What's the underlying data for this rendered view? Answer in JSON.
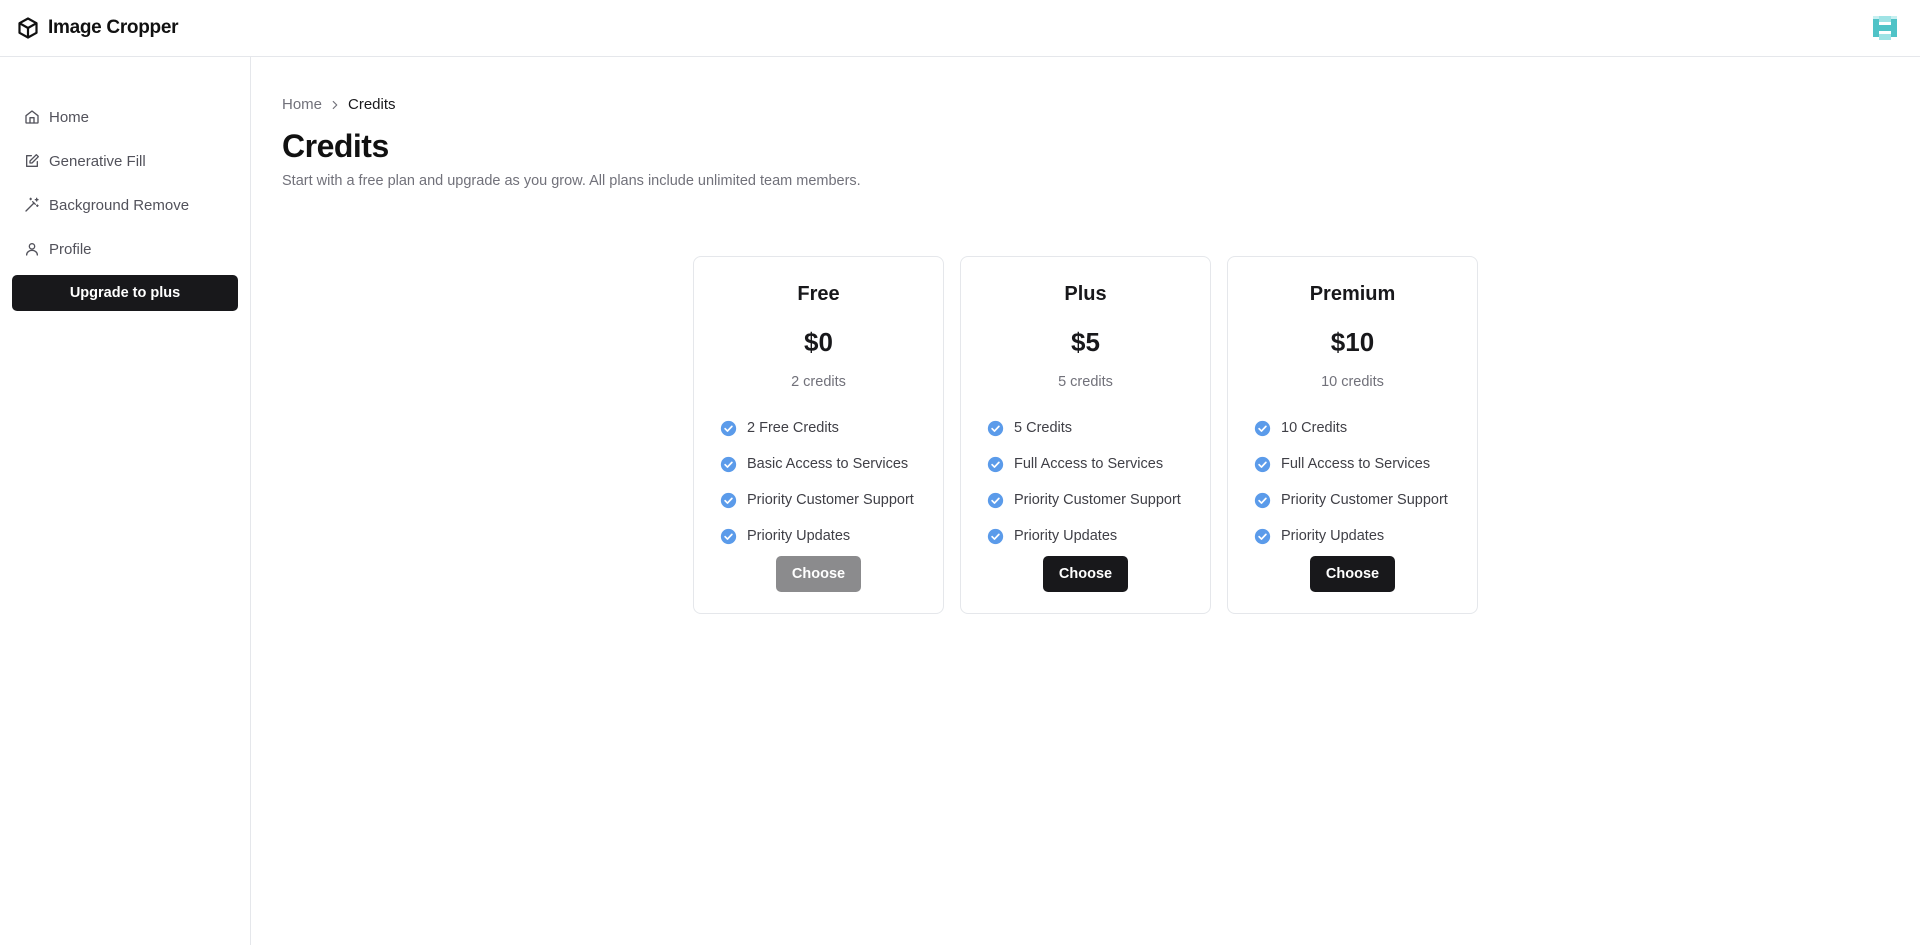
{
  "app": {
    "name": "Image Cropper",
    "logo_icon": "box-icon",
    "avatar_icon": "user-avatar-icon"
  },
  "sidebar": {
    "items": [
      {
        "label": "Home",
        "icon": "home-icon"
      },
      {
        "label": "Generative Fill",
        "icon": "edit-icon"
      },
      {
        "label": "Background Remove",
        "icon": "magic-wand-icon"
      },
      {
        "label": "Profile",
        "icon": "user-icon"
      }
    ],
    "upgrade_label": "Upgrade to plus"
  },
  "breadcrumb": {
    "home": "Home",
    "current": "Credits"
  },
  "page": {
    "title": "Credits",
    "subtitle": "Start with a free plan and upgrade as you grow. All plans include unlimited team members."
  },
  "plans": [
    {
      "name": "Free",
      "price": "$0",
      "credits": "2 credits",
      "features": [
        "2 Free Credits",
        "Basic Access to Services",
        "Priority Customer Support",
        "Priority Updates"
      ],
      "button": "Choose",
      "button_state": "disabled"
    },
    {
      "name": "Plus",
      "price": "$5",
      "credits": "5 credits",
      "features": [
        "5 Credits",
        "Full Access to Services",
        "Priority Customer Support",
        "Priority Updates"
      ],
      "button": "Choose",
      "button_state": "enabled"
    },
    {
      "name": "Premium",
      "price": "$10",
      "credits": "10 credits",
      "features": [
        "10 Credits",
        "Full Access to Services",
        "Priority Customer Support",
        "Priority Updates"
      ],
      "button": "Choose",
      "button_state": "enabled"
    }
  ],
  "colors": {
    "accent_check": "#5b9bea",
    "primary_button": "#18181b",
    "disabled_button": "#8b8b8d",
    "border": "#e5e7eb"
  }
}
